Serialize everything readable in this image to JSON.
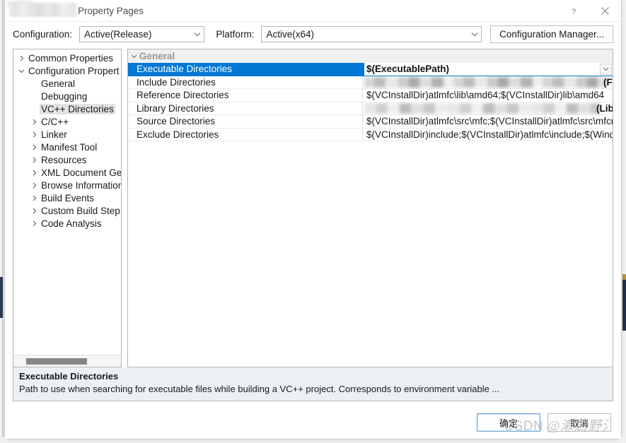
{
  "window": {
    "title_suffix": "Property Pages",
    "title_redacted": true,
    "help_icon": "question-mark-icon",
    "close_icon": "close-icon"
  },
  "toolbar": {
    "configuration_label": "Configuration:",
    "configuration_value": "Active(Release)",
    "platform_label": "Platform:",
    "platform_value": "Active(x64)",
    "config_manager_label": "Configuration Manager...",
    "chevron_icon": "chevron-down-icon"
  },
  "tree": {
    "items": [
      {
        "label": "Common Properties",
        "level": 0,
        "expander": "collapsed",
        "selected": false
      },
      {
        "label": "Configuration Propert",
        "level": 0,
        "expander": "expanded",
        "selected": false
      },
      {
        "label": "General",
        "level": 1,
        "expander": "none",
        "selected": false
      },
      {
        "label": "Debugging",
        "level": 1,
        "expander": "none",
        "selected": false
      },
      {
        "label": "VC++ Directories",
        "level": 1,
        "expander": "none",
        "selected": true
      },
      {
        "label": "C/C++",
        "level": 1,
        "expander": "collapsed",
        "selected": false
      },
      {
        "label": "Linker",
        "level": 1,
        "expander": "collapsed",
        "selected": false
      },
      {
        "label": "Manifest Tool",
        "level": 1,
        "expander": "collapsed",
        "selected": false
      },
      {
        "label": "Resources",
        "level": 1,
        "expander": "collapsed",
        "selected": false
      },
      {
        "label": "XML Document Ge",
        "level": 1,
        "expander": "collapsed",
        "selected": false
      },
      {
        "label": "Browse Information",
        "level": 1,
        "expander": "collapsed",
        "selected": false
      },
      {
        "label": "Build Events",
        "level": 1,
        "expander": "collapsed",
        "selected": false
      },
      {
        "label": "Custom Build Step",
        "level": 1,
        "expander": "collapsed",
        "selected": false
      },
      {
        "label": "Code Analysis",
        "level": 1,
        "expander": "collapsed",
        "selected": false
      }
    ],
    "hscrollbar": true
  },
  "grid": {
    "group_label": "General",
    "group_expander": "expanded",
    "rows": [
      {
        "name": "Executable Directories",
        "value": "$(ExecutablePath)",
        "selected": true,
        "redacted": false,
        "has_dropdown": true
      },
      {
        "name": "Include Directories",
        "value": "",
        "value_tail": "(Framewo",
        "selected": false,
        "redacted": true,
        "redact_style": "a",
        "has_dropdown": false
      },
      {
        "name": "Reference Directories",
        "value": "$(VCInstallDir)atlmfc\\lib\\amd64;$(VCInstallDir)lib\\amd64",
        "selected": false,
        "redacted": false,
        "has_dropdown": false
      },
      {
        "name": "Library Directories",
        "value": "",
        "value_tail": "(Libra",
        "selected": false,
        "redacted": true,
        "redact_style": "b",
        "has_dropdown": false
      },
      {
        "name": "Source Directories",
        "value": "$(VCInstallDir)atlmfc\\src\\mfc;$(VCInstallDir)atlmfc\\src\\mfcm;$(",
        "selected": false,
        "redacted": false,
        "has_dropdown": false
      },
      {
        "name": "Exclude Directories",
        "value": "$(VCInstallDir)include;$(VCInstallDir)atlmfc\\include;$(Windows",
        "selected": false,
        "redacted": false,
        "has_dropdown": false
      }
    ]
  },
  "description": {
    "title": "Executable Directories",
    "text": "Path to use when searching for executable files while building a VC++ project.  Corresponds to environment variable ..."
  },
  "footer": {
    "ok_label": "确定",
    "cancel_label": "取消"
  },
  "watermark": {
    "brand": "CSDN",
    "handle": "@漱启野氵"
  },
  "colors": {
    "selection_blue": "#0078d4",
    "tree_selection_gray": "#e2e2e2",
    "description_bg": "#eceff4",
    "group_header_bg": "#f0f0f0"
  }
}
